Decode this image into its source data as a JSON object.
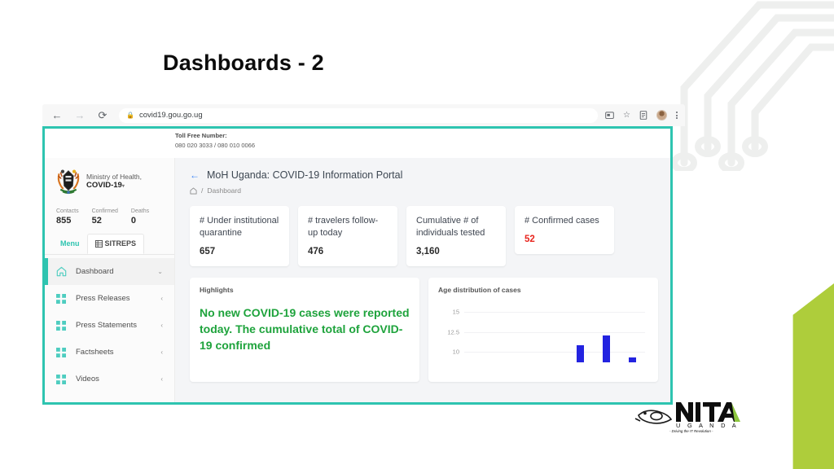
{
  "slide": {
    "title": "Dashboards - 2"
  },
  "browser": {
    "url": "covid19.gou.go.ug",
    "back_icon": "back-arrow-icon",
    "forward_icon": "forward-arrow-icon",
    "reload_icon": "reload-icon",
    "lock_icon": "lock-icon",
    "cast_icon": "cast-icon",
    "bookmark_icon": "star-icon",
    "reader_icon": "reader-mode-icon",
    "profile_icon": "avatar-icon",
    "menu_icon": "kebab-menu-icon"
  },
  "portal": {
    "topbar": {
      "toll_label": "Toll Free Number:",
      "toll_numbers": "080 020 3033 / 080 010 0066"
    },
    "sidebar": {
      "brand_line1": "Ministry of Health,",
      "brand_line2": "COVID-19",
      "brand_caret": "▾",
      "stats": [
        {
          "label": "Contacts",
          "value": "855"
        },
        {
          "label": "Confirmed",
          "value": "52"
        },
        {
          "label": "Deaths",
          "value": "0"
        }
      ],
      "tabs": [
        {
          "label": "Menu",
          "active": true
        },
        {
          "label": "SITREPS",
          "active": false
        }
      ],
      "nav": [
        {
          "label": "Dashboard",
          "icon": "home-icon",
          "chevron": "⌄",
          "active": true
        },
        {
          "label": "Press Releases",
          "icon": "grid-icon",
          "chevron": "‹",
          "active": false
        },
        {
          "label": "Press Statements",
          "icon": "grid-icon",
          "chevron": "‹",
          "active": false
        },
        {
          "label": "Factsheets",
          "icon": "grid-icon",
          "chevron": "‹",
          "active": false
        },
        {
          "label": "Videos",
          "icon": "grid-icon",
          "chevron": "‹",
          "active": false
        }
      ]
    },
    "header": {
      "title": "MoH Uganda: COVID-19 Information Portal",
      "back_icon": "back-arrow-icon",
      "home_icon": "home-icon",
      "crumb_separator": "/",
      "crumb_current": "Dashboard"
    },
    "cards": [
      {
        "title": "# Under institutional quarantine",
        "value": "657",
        "highlight": false
      },
      {
        "title": "# travelers follow-up today",
        "value": "476",
        "highlight": false
      },
      {
        "title": "Cumulative # of individuals tested",
        "value": "3,160",
        "highlight": false
      },
      {
        "title": "# Confirmed cases",
        "value": "52",
        "highlight": true
      }
    ],
    "highlights": {
      "panel_title": "Highlights",
      "text": "No new COVID-19 cases were reported today. The cumulative total of COVID-19 confirmed"
    },
    "chart_panel": {
      "panel_title": "Age distribution of cases"
    }
  },
  "chart_data": {
    "type": "bar",
    "title": "Age distribution of cases",
    "xlabel": "",
    "ylabel": "",
    "ylim": [
      9,
      16.25
    ],
    "yticks": [
      "15",
      "12.5",
      "10"
    ],
    "ytick_values": [
      15,
      12.5,
      10
    ],
    "grid": true,
    "legend": "none",
    "categories": [
      "",
      "",
      "",
      "",
      "",
      "",
      ""
    ],
    "values": [
      0,
      0,
      0,
      0,
      11.2,
      12.4,
      9.6
    ],
    "bar_color": "#2323e0",
    "note": "Chart is vertically cropped by the slide frame; only the top of the plot area is visible."
  },
  "colors": {
    "teal_frame": "#2ec4b0",
    "accent_green": "#aecd3b",
    "confirmed_red": "#e8241d",
    "highlight_green": "#1ea33c",
    "bar_blue": "#2323e0"
  },
  "footer_logo": {
    "name": "NITA",
    "country": "U G A N D A",
    "tagline": "- Driving the IT Revolution -"
  }
}
